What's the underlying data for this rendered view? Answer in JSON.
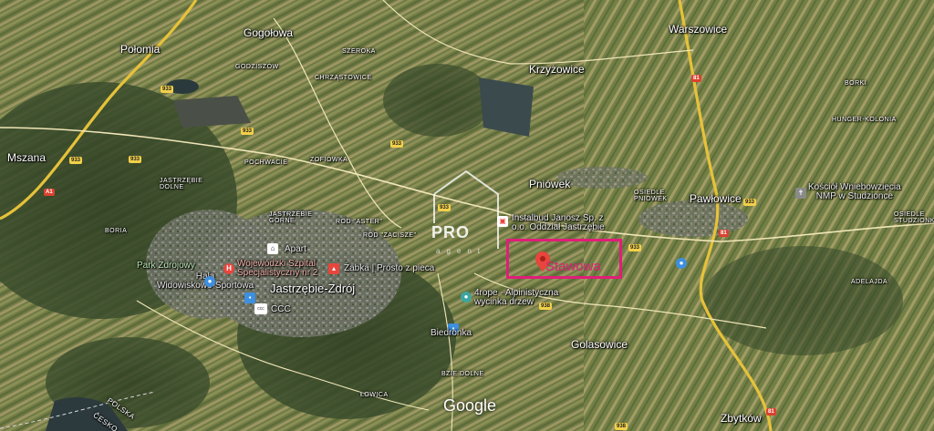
{
  "map": {
    "highlight_label": "Stawowa",
    "attribution": "Google",
    "logo_text": "PRO",
    "logo_subtext": "agent",
    "colors": {
      "highlight": "#e01e78",
      "pin": "#e8453c",
      "road_major": "#f2c542",
      "route_shield": "#f2d049"
    },
    "places": {
      "polomia": "Połomia",
      "gogolowa": "Gogołowa",
      "godziszow": "GODZISZÓW",
      "szeroka": "SZEROKA",
      "chrzastowice": "CHRZĄSTOWICE",
      "krzyzowice": "Krzyżowice",
      "warszowice": "Warszowice",
      "mszana": "Mszana",
      "jastrzebie_dolne": "JASTRZĘBIE\nDOLNE",
      "jastrzebie_gorne": "JASTRZĘBIE\nGÓRNE",
      "pochwacie": "POCHWACIE",
      "zofiowka": "ZOFIÓWKA",
      "rod_aster": "ROD \"ASTER\"",
      "rod_zacisze": "ROD \"ZACISZE\"",
      "pniowek": "Pniówek",
      "osiedle_pniowek": "OSIEDLE\nPNIÓWEK",
      "pawlowice": "Pawłowice",
      "hunger_kolonia": "HUNGER-KOLONIA",
      "borki": "BORKI",
      "osiedle_studzionka": "OSIEDLE\nSTUDZIONKA",
      "adelajda": "ADELAJDA",
      "jastrzebie_zdroj": "Jastrzębie-Zdrój",
      "boria": "BORIA",
      "bzie_dolne": "BZIE DOLNE",
      "golasowice": "Golasowice",
      "zbytkow": "Zbytków",
      "polska": "POLSKA",
      "cesko": "ČESKO",
      "dolne_gorne": "ŁOWICA"
    },
    "pois": {
      "apart": "Apart",
      "szpital": "Wojewódzki Szpital\nSpecjalistyczny nr 2",
      "zabka": "Żabka | Prosto z pieca",
      "park": "Park Zdrojowy",
      "hala": "Hala\nWidowiskowo-Sportowa",
      "ccc": "CCC",
      "instalbud": "Instalbud Janosz Sp. z\no.o. Oddział Jastrzębie",
      "alpinistyczna": "4rope - Alpinistyczna\nwycinka drzew",
      "biedronka": "Biedronka",
      "kosciol": "Kościół Wniebowzięcia\nNMP w Studzionce"
    },
    "routes": {
      "r933": "933",
      "r81": "81",
      "r938": "938",
      "a1": "A1"
    }
  }
}
